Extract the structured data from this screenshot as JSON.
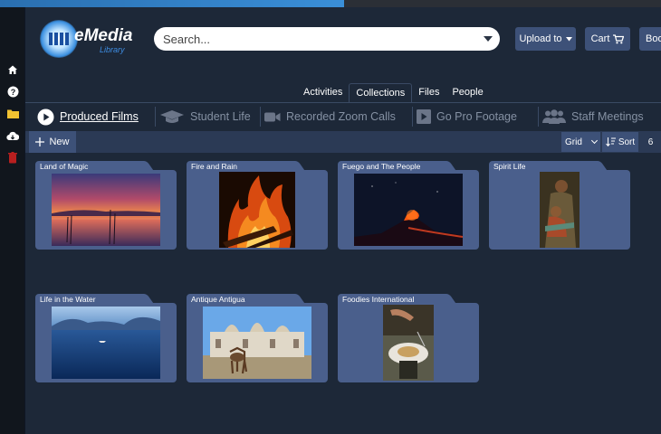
{
  "sidebar": {
    "icons": [
      "home-icon",
      "help-icon",
      "folder-icon",
      "cloud-download-icon",
      "trash-icon"
    ]
  },
  "header": {
    "logo_text": "eMedia",
    "logo_subtext": "Library",
    "search_placeholder": "Search...",
    "upload_label": "Upload to",
    "cart_label": "Cart",
    "book_label": "Boo"
  },
  "tabs": [
    {
      "label": "Activities",
      "active": false
    },
    {
      "label": "Collections",
      "active": true
    },
    {
      "label": "Files",
      "active": false
    },
    {
      "label": "People",
      "active": false
    }
  ],
  "collections": [
    {
      "label": "Produced Films",
      "icon": "play-icon",
      "active": true
    },
    {
      "label": "Student Life",
      "icon": "graduation-cap-icon",
      "active": false
    },
    {
      "label": "Recorded Zoom Calls",
      "icon": "video-camera-icon",
      "active": false
    },
    {
      "label": "Go Pro Footage",
      "icon": "play-square-icon",
      "active": false
    },
    {
      "label": "Staff Meetings",
      "icon": "users-icon",
      "active": false
    }
  ],
  "toolbar": {
    "new_label": "New",
    "view_label": "Grid",
    "sort_label": "Sort",
    "count": "6"
  },
  "folders": [
    {
      "name": "Land of Magic",
      "image": "sunset-lake"
    },
    {
      "name": "Fire and Rain",
      "image": "campfire"
    },
    {
      "name": "Fuego and The People",
      "image": "volcano-night"
    },
    {
      "name": "Spirit Life",
      "image": "mother-child"
    },
    {
      "name": "Life in the Water",
      "image": "blue-lake"
    },
    {
      "name": "Antique Antigua",
      "image": "town-donkey"
    },
    {
      "name": "Foodies International",
      "image": "food-plate"
    }
  ],
  "colors": {
    "background": "#1d2838",
    "folder": "#4a5f8c",
    "button": "#3d5178",
    "accent": "#3a8fe0"
  }
}
